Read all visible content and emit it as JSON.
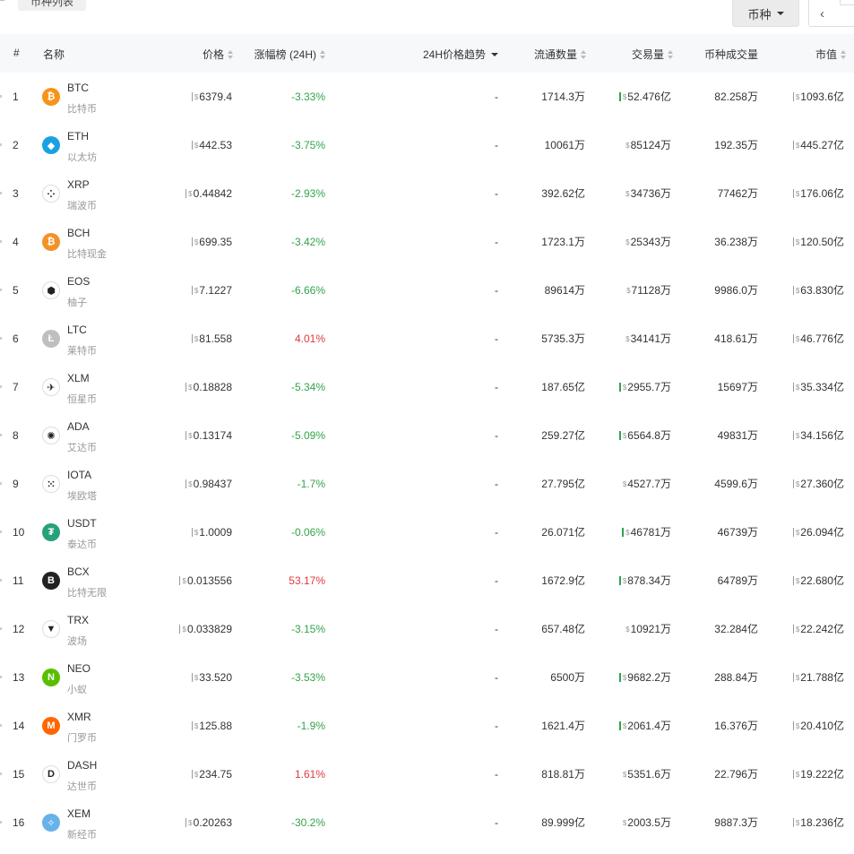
{
  "top": {
    "tab_stub": "ᄃ",
    "tab_label": "币种列表",
    "coin_dropdown": "币种",
    "prev_icon": "‹"
  },
  "header": {
    "rank": "#",
    "name": "名称",
    "price": "价格",
    "change": "涨幅榜 (24H)",
    "trend": "24H价格趋势",
    "supply": "流通数量",
    "volume": "交易量",
    "coin_volume": "币种成交量",
    "market_cap": "市值"
  },
  "currency_symbol": "$",
  "rows": [
    {
      "rank": "1",
      "symbol": "BTC",
      "name": "比特币",
      "price": "6379.4",
      "change": "-3.33%",
      "trend": "-",
      "supply": "1714.3万",
      "volume": "52.476亿",
      "coin_volume": "82.258万",
      "market_cap": "1093.6亿",
      "logo": "bitcoin-icon",
      "color": "#f7931a",
      "glyph": "₿"
    },
    {
      "rank": "2",
      "symbol": "ETH",
      "name": "以太坊",
      "price": "442.53",
      "change": "-3.75%",
      "trend": "-",
      "supply": "10061万",
      "volume": "85124万",
      "coin_volume": "192.35万",
      "market_cap": "445.27亿",
      "logo": "ethereum-icon",
      "color": "#1ba1e2",
      "glyph": "◆"
    },
    {
      "rank": "3",
      "symbol": "XRP",
      "name": "瑞波币",
      "price": "0.44842",
      "change": "-2.93%",
      "trend": "-",
      "supply": "392.62亿",
      "volume": "34736万",
      "coin_volume": "77462万",
      "market_cap": "176.06亿",
      "logo": "ripple-icon",
      "color": "#ffffff",
      "glyph": "⁘"
    },
    {
      "rank": "4",
      "symbol": "BCH",
      "name": "比特现金",
      "price": "699.35",
      "change": "-3.42%",
      "trend": "-",
      "supply": "1723.1万",
      "volume": "25343万",
      "coin_volume": "36.238万",
      "market_cap": "120.50亿",
      "logo": "bitcoin-cash-icon",
      "color": "#f29227",
      "glyph": "₿"
    },
    {
      "rank": "5",
      "symbol": "EOS",
      "name": "柚子",
      "price": "7.1227",
      "change": "-6.66%",
      "trend": "-",
      "supply": "89614万",
      "volume": "71128万",
      "coin_volume": "9986.0万",
      "market_cap": "63.830亿",
      "logo": "eos-icon",
      "color": "#ffffff",
      "glyph": "⬢"
    },
    {
      "rank": "6",
      "symbol": "LTC",
      "name": "莱特币",
      "price": "81.558",
      "change": "4.01%",
      "trend": "-",
      "supply": "5735.3万",
      "volume": "34141万",
      "coin_volume": "418.61万",
      "market_cap": "46.776亿",
      "logo": "litecoin-icon",
      "color": "#bfbfbf",
      "glyph": "Ł"
    },
    {
      "rank": "7",
      "symbol": "XLM",
      "name": "恒星币",
      "price": "0.18828",
      "change": "-5.34%",
      "trend": "-",
      "supply": "187.65亿",
      "volume": "2955.7万",
      "coin_volume": "15697万",
      "market_cap": "35.334亿",
      "logo": "stellar-rocket-icon",
      "color": "#ffffff",
      "glyph": "✈"
    },
    {
      "rank": "8",
      "symbol": "ADA",
      "name": "艾达币",
      "price": "0.13174",
      "change": "-5.09%",
      "trend": "-",
      "supply": "259.27亿",
      "volume": "6564.8万",
      "coin_volume": "49831万",
      "market_cap": "34.156亿",
      "logo": "cardano-icon",
      "color": "#ffffff",
      "glyph": "✺"
    },
    {
      "rank": "9",
      "symbol": "IOTA",
      "name": "埃欧塔",
      "price": "0.98437",
      "change": "-1.7%",
      "trend": "-",
      "supply": "27.795亿",
      "volume": "4527.7万",
      "coin_volume": "4599.6万",
      "market_cap": "27.360亿",
      "logo": "iota-icon",
      "color": "#ffffff",
      "glyph": "⁙"
    },
    {
      "rank": "10",
      "symbol": "USDT",
      "name": "泰达币",
      "price": "1.0009",
      "change": "-0.06%",
      "trend": "-",
      "supply": "26.071亿",
      "volume": "46781万",
      "coin_volume": "46739万",
      "market_cap": "26.094亿",
      "logo": "tether-icon",
      "color": "#26a17b",
      "glyph": "₮"
    },
    {
      "rank": "11",
      "symbol": "BCX",
      "name": "比特无限",
      "price": "0.013556",
      "change": "53.17%",
      "trend": "-",
      "supply": "1672.9亿",
      "volume": "878.34万",
      "coin_volume": "64789万",
      "market_cap": "22.680亿",
      "logo": "bitcoinx-icon",
      "color": "#222222",
      "glyph": "B"
    },
    {
      "rank": "12",
      "symbol": "TRX",
      "name": "波场",
      "price": "0.033829",
      "change": "-3.15%",
      "trend": "-",
      "supply": "657.48亿",
      "volume": "10921万",
      "coin_volume": "32.284亿",
      "market_cap": "22.242亿",
      "logo": "tron-icon",
      "color": "#ffffff",
      "glyph": "▼"
    },
    {
      "rank": "13",
      "symbol": "NEO",
      "name": "小蚁",
      "price": "33.520",
      "change": "-3.53%",
      "trend": "-",
      "supply": "6500万",
      "volume": "9682.2万",
      "coin_volume": "288.84万",
      "market_cap": "21.788亿",
      "logo": "neo-icon",
      "color": "#58bf00",
      "glyph": "N"
    },
    {
      "rank": "14",
      "symbol": "XMR",
      "name": "门罗币",
      "price": "125.88",
      "change": "-1.9%",
      "trend": "-",
      "supply": "1621.4万",
      "volume": "2061.4万",
      "coin_volume": "16.376万",
      "market_cap": "20.410亿",
      "logo": "monero-icon",
      "color": "#ff6600",
      "glyph": "M"
    },
    {
      "rank": "15",
      "symbol": "DASH",
      "name": "达世币",
      "price": "234.75",
      "change": "1.61%",
      "trend": "-",
      "supply": "818.81万",
      "volume": "5351.6万",
      "coin_volume": "22.796万",
      "market_cap": "19.222亿",
      "logo": "dash-icon",
      "color": "#ffffff",
      "glyph": "D"
    },
    {
      "rank": "16",
      "symbol": "XEM",
      "name": "新经币",
      "price": "0.20263",
      "change": "-30.2%",
      "trend": "-",
      "supply": "89.999亿",
      "volume": "2003.5万",
      "coin_volume": "9887.3万",
      "market_cap": "18.236亿",
      "logo": "nem-icon",
      "color": "#67b2e8",
      "glyph": "✧"
    }
  ]
}
